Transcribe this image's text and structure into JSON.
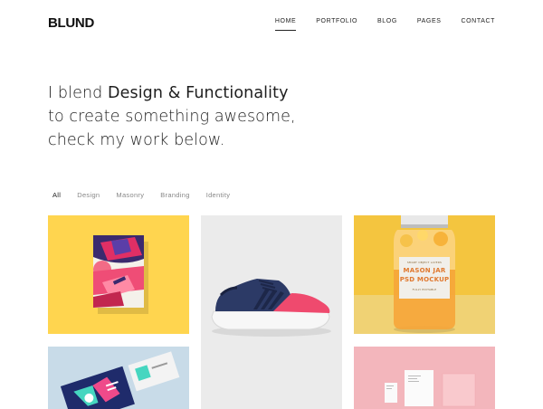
{
  "brand": {
    "logo": "BLUND"
  },
  "nav": {
    "items": [
      {
        "label": "HOME",
        "active": true
      },
      {
        "label": "PORTFOLIO",
        "active": false
      },
      {
        "label": "BLOG",
        "active": false
      },
      {
        "label": "PAGES",
        "active": false
      },
      {
        "label": "CONTACT",
        "active": false
      }
    ]
  },
  "hero": {
    "line1_prefix": "I blend ",
    "line1_strong": "Design & Functionality",
    "line2": "to create something awesome,",
    "line3": "check my work below."
  },
  "filters": {
    "items": [
      {
        "label": "All",
        "active": true
      },
      {
        "label": "Design",
        "active": false
      },
      {
        "label": "Masonry",
        "active": false
      },
      {
        "label": "Branding",
        "active": false
      },
      {
        "label": "Identity",
        "active": false
      }
    ]
  },
  "portfolio": {
    "items": [
      {
        "image": "poster-artwork",
        "background": "#ffd54f"
      },
      {
        "image": "sneaker-photo",
        "background": "#ebebeb"
      },
      {
        "image": "mason-jar-mockup",
        "background": "#f4c53f",
        "jar_label_1": "MASON JAR",
        "jar_label_2": "PSD MOCKUP",
        "jar_label_top": "SMART OBJECT LAYERS",
        "jar_label_bottom": "FULLY EDITABLE"
      },
      {
        "image": "business-card-mockup",
        "background": "#c8dbe8"
      },
      {
        "image": "stationery-mockup",
        "background": "#f3b6bc"
      }
    ]
  }
}
